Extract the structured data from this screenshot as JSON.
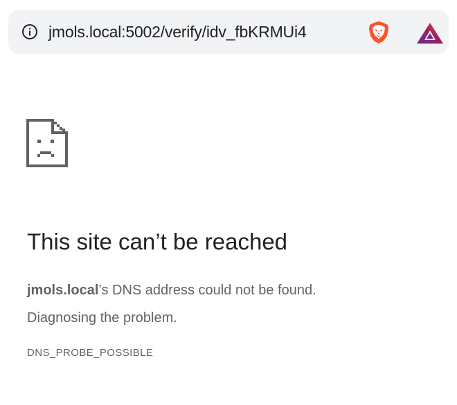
{
  "omnibox": {
    "info_icon": "info-circle-icon",
    "url_host": "jmols.local",
    "url_rest": ":5002/verify/idv_fbKRMUi4",
    "extensions": [
      {
        "name": "brave-shields-icon",
        "color": "#fb542b"
      },
      {
        "name": "brave-rewards-icon",
        "color": "#662d91"
      }
    ]
  },
  "error": {
    "icon": "sad-page-icon",
    "title": "This site can’t be reached",
    "host": "jmols.local",
    "message_suffix": "’s DNS address could not be found.",
    "diagnosing": "Diagnosing the problem.",
    "code": "DNS_PROBE_POSSIBLE"
  },
  "colors": {
    "omnibox_bg": "#f1f3f4",
    "text_primary": "#202124",
    "text_secondary": "#5f6368"
  }
}
